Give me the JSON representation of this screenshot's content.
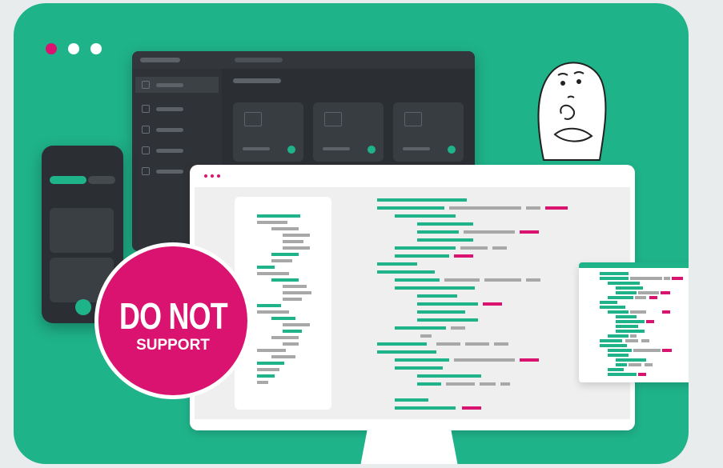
{
  "badge": {
    "line1": "DO NOT",
    "line2": "SUPPORT"
  },
  "colors": {
    "background_card": "#1fb38a",
    "accent_pink": "#d9136f",
    "dark_ui": "#2b2f33"
  },
  "icons": [
    "window-dots-icon",
    "thinking-character-illustration"
  ]
}
